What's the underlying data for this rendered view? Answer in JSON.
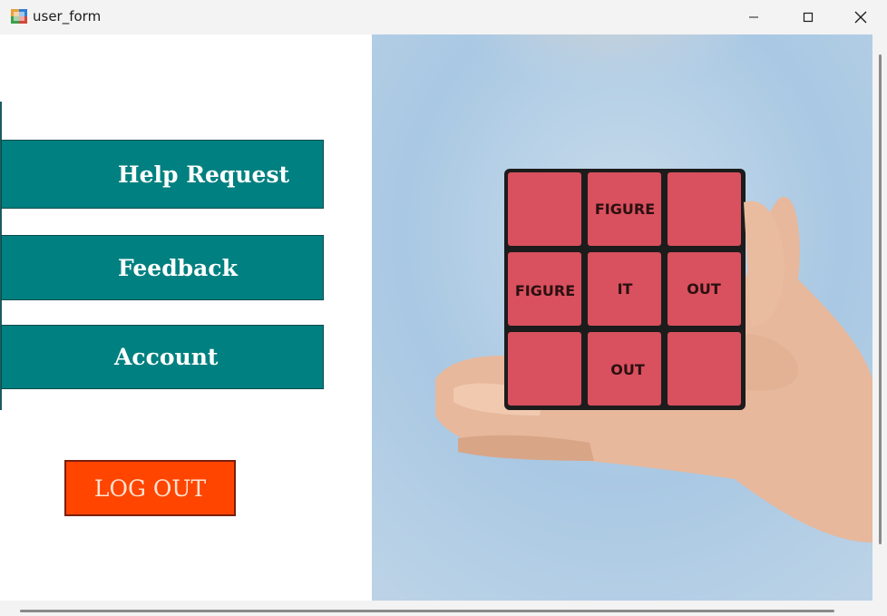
{
  "window": {
    "title": "user_form"
  },
  "nav": {
    "help_label": "Help Request",
    "feedback_label": "Feedback",
    "account_label": "Account"
  },
  "logout": {
    "label": "LOG OUT"
  },
  "picture": {
    "tiles": [
      "FIGURE",
      "FIGURE",
      "IT",
      "OUT",
      "OUT"
    ]
  },
  "colors": {
    "nav_button": "#008080",
    "logout_button": "#ff4500",
    "cube_tile": "#d9505e"
  }
}
